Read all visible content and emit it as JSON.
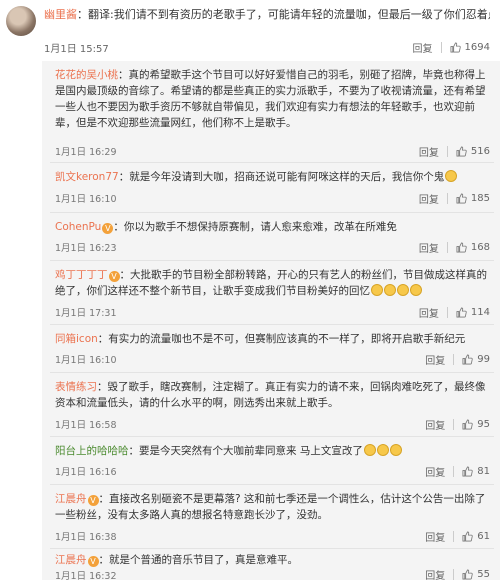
{
  "top_comment": {
    "user": "幽里酱",
    "text": "：翻译:我们请不到有资历的老歌手了，可能请年轻的流量咖，但最后一级了你们忍着点麻烦了",
    "date": "1月1日 15:57",
    "reply_label": "回复",
    "likes": "1694"
  },
  "replies": [
    {
      "user": "花花的吴小桃",
      "text": "：真的希望歌手这个节目可以好好爱惜自己的羽毛，别砸了招牌，毕竟也称得上是国内最顶级的音综了。希望请的都是些真正的实力派歌手，不要为了收视请流量，还有希望一些人也不要因为歌手资历不够就自带偏见，我们欢迎有实力有想法的年轻歌手，也欢迎前辈，但是不欢迎那些流量网红，他们称不上是歌手。",
      "date": "1月1日 16:29",
      "reply_label": "回复",
      "likes": "516"
    },
    {
      "user": "凯文keron77",
      "text": "：就是今年没请到大咖，招商还说可能有阿咪这样的天后，我信你个鬼",
      "date": "1月1日 16:10",
      "reply_label": "回复",
      "likes": "185"
    },
    {
      "user": "CohenPu",
      "text": "：你以为歌手不想保持原赛制，请人愈来愈难，改革在所难免",
      "date": "1月1日 16:23",
      "reply_label": "回复",
      "likes": "168"
    },
    {
      "user": "鸡丁丁丁丁",
      "text": "：大批歌手的节目粉全部粉转路，开心的只有艺人的粉丝们，节目做成这样真的绝了，你们这样还不整个新节目，让歌手变成我们节目粉美好的回忆",
      "date": "1月1日 17:31",
      "reply_label": "回复",
      "likes": "114"
    },
    {
      "user": "同箱icon",
      "text": "：有实力的流量咖也不是不可，但赛制应该真的不一样了，即将开启歌手新纪元",
      "date": "1月1日 16:10",
      "reply_label": "回复",
      "likes": "99"
    },
    {
      "user": "表情练习",
      "text": "：毁了歌手，瞎改赛制，注定糊了。真正有实力的请不来，回锅肉难吃死了，最终像资本和流量低头，请的什么水平的啊，刚选秀出来就上歌手。",
      "date": "1月1日 16:58",
      "reply_label": "回复",
      "likes": "95"
    },
    {
      "user": "阳台上的哈哈哈",
      "text": "：要是今天突然有个大咖前辈同意来 马上文宣改了",
      "date": "1月1日 16:16",
      "reply_label": "回复",
      "likes": "81"
    },
    {
      "user": "江晨舟",
      "text": "：直接改名别砸瓷不是更幕落? 这和前七季还是一个调性么，估计这个公告一出除了一些粉丝，没有太多路人真的想报名特意跑长沙了，没劲。",
      "date": "1月1日 16:38",
      "reply_label": "回复",
      "likes": "61"
    },
    {
      "user": "江晨舟",
      "text": "：就是个普通的音乐节目了，真是意难平。",
      "date": "1月1日 16:32",
      "reply_label": "回复",
      "likes": "55"
    }
  ],
  "colors": {
    "username": "#eb7350",
    "thread_bg": "#f4f4f4",
    "meta": "#777777"
  },
  "icons": {
    "like": "thumbs-up-icon",
    "vip": "vip-badge-icon",
    "emoji": "smile-emoji-icon"
  }
}
